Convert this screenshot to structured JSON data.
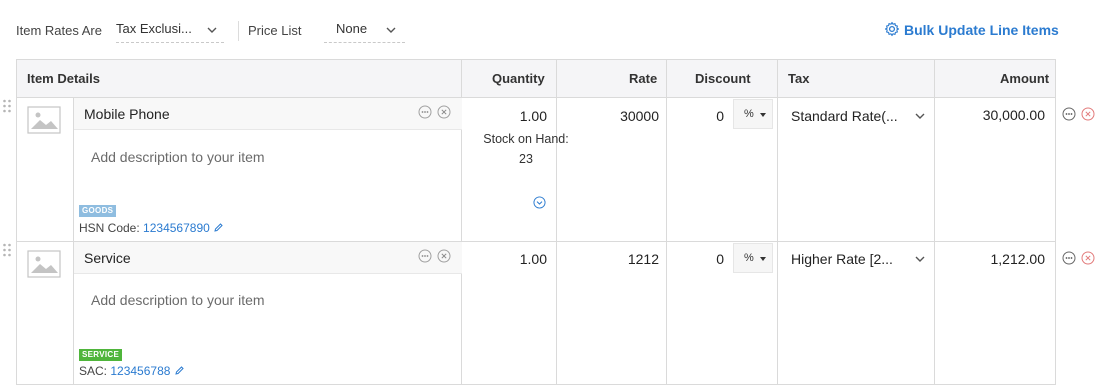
{
  "toolbar": {
    "item_rates_label": "Item Rates Are",
    "item_rates_value": "Tax Exclusi...",
    "price_list_label": "Price List",
    "price_list_value": "None",
    "bulk_update_label": "Bulk Update Line Items"
  },
  "table": {
    "headers": {
      "item_details": "Item Details",
      "quantity": "Quantity",
      "rate": "Rate",
      "discount": "Discount",
      "tax": "Tax",
      "amount": "Amount"
    },
    "rows": [
      {
        "name": "Mobile Phone",
        "description_placeholder": "Add description to your item",
        "quantity": "1.00",
        "stock_label": "Stock on Hand:",
        "stock_value": "23",
        "rate": "30000",
        "discount": "0",
        "discount_unit": "%",
        "tax": "Standard Rate(...",
        "amount": "30,000.00",
        "type_badge": "GOODS",
        "code_label": "HSN Code:",
        "code_value": "1234567890"
      },
      {
        "name": "Service",
        "description_placeholder": "Add description to your item",
        "quantity": "1.00",
        "rate": "1212",
        "discount": "0",
        "discount_unit": "%",
        "tax": "Higher Rate [2...",
        "amount": "1,212.00",
        "type_badge": "SERVICE",
        "code_label": "SAC:",
        "code_value": "123456788"
      }
    ]
  },
  "colors": {
    "link": "#2b7bd0",
    "goods_badge": "#8fbde0",
    "service_badge": "#4fb53b",
    "remove": "#e27a7a",
    "border": "#dadada"
  },
  "icons": [
    "chevron-down-icon",
    "gear-icon",
    "image-placeholder-icon",
    "more-icon",
    "close-circle-icon",
    "chevron-circle-down-icon",
    "pencil-icon",
    "drag-handle-icon"
  ]
}
